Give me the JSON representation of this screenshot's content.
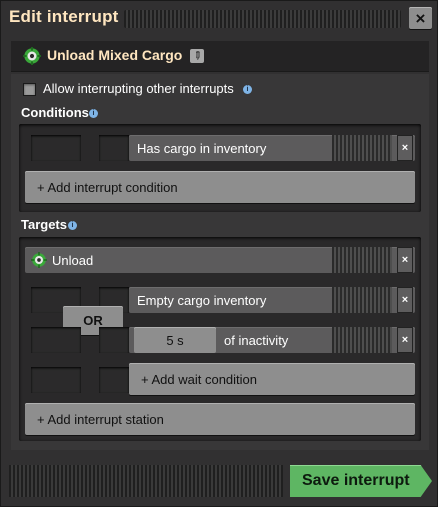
{
  "window": {
    "title": "Edit interrupt",
    "close_label": "×"
  },
  "interrupt": {
    "name": "Unload Mixed Cargo",
    "icon": "gear-icon",
    "rename_icon": "pencil-icon"
  },
  "options": {
    "allow_interrupting_label": "Allow interrupting other interrupts",
    "allow_interrupting_checked": false
  },
  "conditions": {
    "heading": "Conditions",
    "items": [
      {
        "label": "Has cargo in inventory"
      }
    ],
    "add_label": "+ Add interrupt condition"
  },
  "targets": {
    "heading": "Targets",
    "stations": [
      {
        "name": "Unload",
        "connector": "OR",
        "wait_conditions": [
          {
            "label": "Empty cargo inventory"
          },
          {
            "value": "5 s",
            "suffix": "of inactivity"
          }
        ],
        "add_wait_label": "+ Add wait condition"
      }
    ],
    "add_station_label": "+ Add interrupt station"
  },
  "footer": {
    "save_label": "Save interrupt"
  },
  "colors": {
    "accent_title": "#ffe6c0",
    "save_green": "#5eb663",
    "info_blue": "#7fb4e6"
  }
}
